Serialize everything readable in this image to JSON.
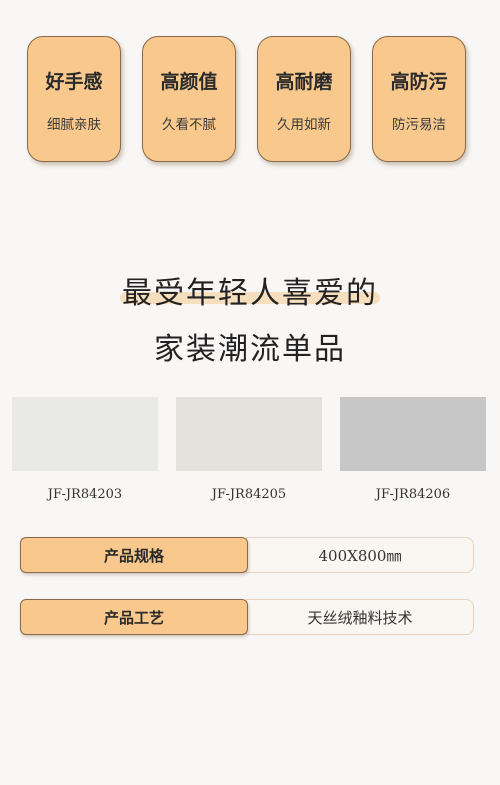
{
  "features": [
    {
      "title": "好手感",
      "sub": "细腻亲肤"
    },
    {
      "title": "高颜值",
      "sub": "久看不腻"
    },
    {
      "title": "高耐磨",
      "sub": "久用如新"
    },
    {
      "title": "高防污",
      "sub": "防污易洁"
    }
  ],
  "headline": {
    "line1": "最受年轻人喜爱的",
    "line2": "家装潮流单品"
  },
  "products": [
    {
      "code": "JF-JR84203",
      "color": "#e9e9e8"
    },
    {
      "code": "JF-JR84205",
      "color": "#e5e1db"
    },
    {
      "code": "JF-JR84206",
      "color": "#c7c7c7"
    }
  ],
  "specs": [
    {
      "label": "产品规格",
      "value": "400X800㎜"
    },
    {
      "label": "产品工艺",
      "value": "天丝绒釉料技术"
    }
  ]
}
